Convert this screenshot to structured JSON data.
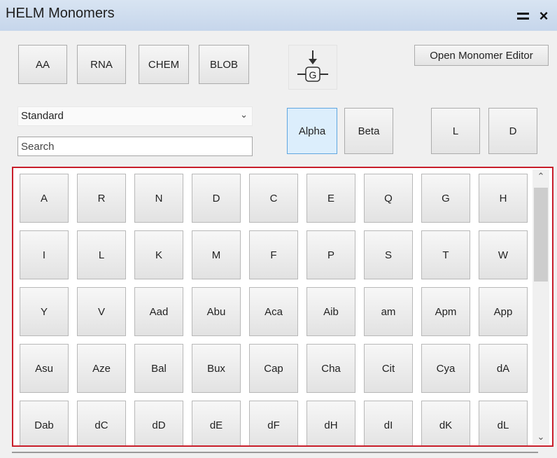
{
  "window": {
    "title": "HELM Monomers",
    "menu_icon": "menu-lines-icon",
    "close_label": "×",
    "close_icon": "close-icon"
  },
  "types": [
    {
      "label": "AA",
      "selected": true
    },
    {
      "label": "RNA",
      "selected": false
    },
    {
      "label": "CHEM",
      "selected": false
    },
    {
      "label": "BLOB",
      "selected": false
    }
  ],
  "add_icon": "add-monomer-g-icon",
  "editor_button_label": "Open Monomer Editor",
  "category_select": {
    "value": "Standard"
  },
  "search": {
    "placeholder": "Search"
  },
  "backbone": [
    {
      "label": "Alpha",
      "selected": true
    },
    {
      "label": "Beta",
      "selected": false
    }
  ],
  "chirality": [
    {
      "label": "L",
      "selected": false
    },
    {
      "label": "D",
      "selected": false
    }
  ],
  "monomers": [
    "A",
    "R",
    "N",
    "D",
    "C",
    "E",
    "Q",
    "G",
    "H",
    "I",
    "L",
    "K",
    "M",
    "F",
    "P",
    "S",
    "T",
    "W",
    "Y",
    "V",
    "Aad",
    "Abu",
    "Aca",
    "Aib",
    "am",
    "Apm",
    "App",
    "Asu",
    "Aze",
    "Bal",
    "Bux",
    "Cap",
    "Cha",
    "Cit",
    "Cya",
    "dA",
    "Dab",
    "dC",
    "dD",
    "dE",
    "dF",
    "dH",
    "dI",
    "dK",
    "dL"
  ],
  "colors": {
    "selection_border": "#c81e2a",
    "selected_button": "#dceefc",
    "title_bar": "#d0ddef"
  }
}
